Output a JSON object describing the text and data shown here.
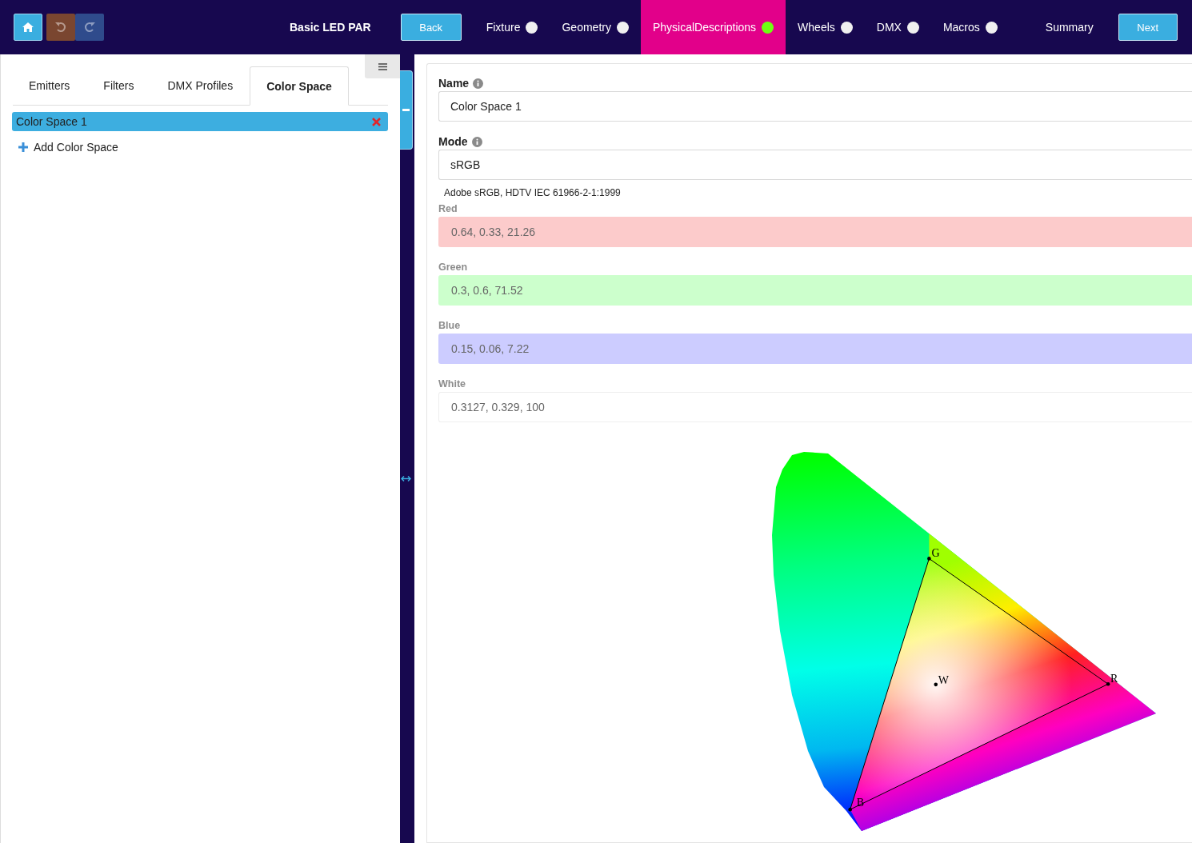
{
  "header": {
    "undo": {
      "disabled": true
    },
    "redo": {
      "disabled": true
    },
    "title": "Basic LED PAR",
    "back_label": "Back",
    "next_label": "Next",
    "steps": [
      {
        "label": "Fixture",
        "kind": "step",
        "done": false,
        "selected": false
      },
      {
        "label": "Geometry",
        "kind": "step",
        "done": false,
        "selected": false
      },
      {
        "label": "PhysicalDescriptions",
        "kind": "step",
        "done": true,
        "selected": true
      },
      {
        "label": "Wheels",
        "kind": "step",
        "done": false,
        "selected": false
      },
      {
        "label": "DMX",
        "kind": "step",
        "done": false,
        "selected": false
      },
      {
        "label": "Macros",
        "kind": "step",
        "done": false,
        "selected": false
      },
      {
        "label": "Summary",
        "kind": "plain",
        "selected": false
      }
    ]
  },
  "side_panel": {
    "tabs": [
      {
        "label": "Emitters",
        "selected": false
      },
      {
        "label": "Filters",
        "selected": false
      },
      {
        "label": "DMX Profiles",
        "selected": false
      },
      {
        "label": "Color Space",
        "selected": true
      }
    ],
    "items": [
      {
        "label": "Color Space 1",
        "selected": true
      }
    ],
    "add_label": "Add Color Space"
  },
  "form": {
    "name": {
      "label": "Name",
      "value": "Color Space 1"
    },
    "mode": {
      "label": "Mode",
      "value": "sRGB"
    },
    "description": "Adobe sRGB, HDTV IEC 61966-2-1:1999",
    "primaries": [
      {
        "label": "Red",
        "value": "0.64, 0.33, 21.26",
        "color": "#fccbcb",
        "disabled": true,
        "point_label": "R"
      },
      {
        "label": "Green",
        "value": "0.3, 0.6, 71.52",
        "color": "#ccffcc",
        "disabled": true,
        "point_label": "G"
      },
      {
        "label": "Blue",
        "value": "0.15, 0.06, 7.22",
        "color": "#ccccff",
        "disabled": true,
        "point_label": "B"
      },
      {
        "label": "White",
        "value": "0.3127, 0.329, 100",
        "color": "#ffffff",
        "disabled": true,
        "point_label": "W"
      }
    ]
  }
}
